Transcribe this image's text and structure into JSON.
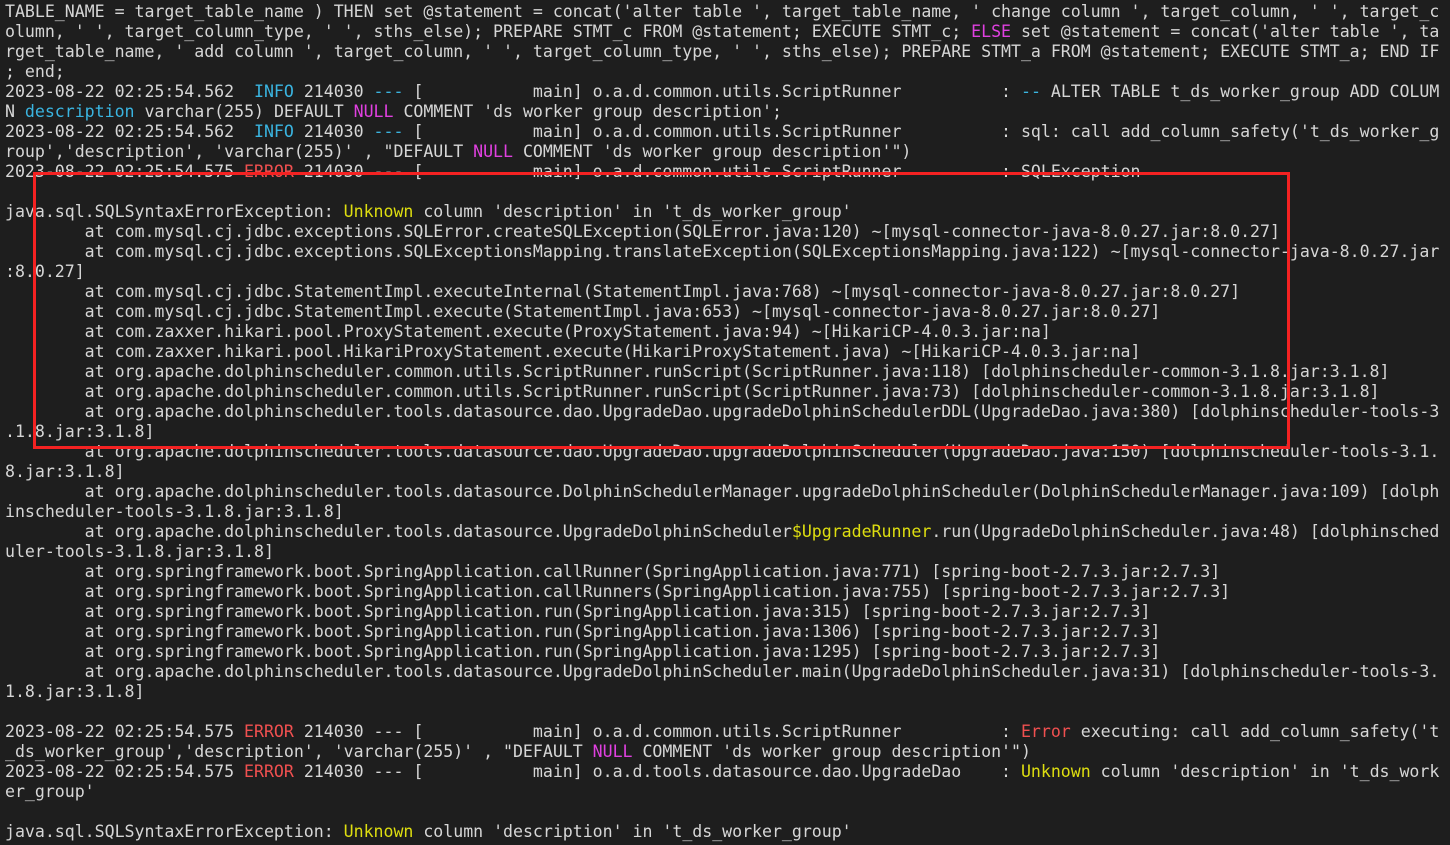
{
  "colors": {
    "background": "#1e1e1e",
    "text": "#d6d6d6",
    "info": "#3ab4e0",
    "null_keyword": "#e040e0",
    "error": "#f05050",
    "highlight": "#dede10",
    "annotation_box": "#f42222"
  },
  "lines": [
    [
      {
        "t": "TABLE_NAME = target_table_name ) THEN set @statement = concat('alter table ', target_table_name, ' change column ', target_column, ' ', target_c"
      }
    ],
    [
      {
        "t": "olumn, ' ', target_column_type, ' ', sths_else); PREPARE STMT_c FROM @statement; EXECUTE STMT_c; "
      },
      {
        "t": "ELSE",
        "c": "m"
      },
      {
        "t": " set @statement = concat('alter table ', ta"
      }
    ],
    [
      {
        "t": "rget_table_name, ' add column ', target_column, ' ', target_column_type, ' ', sths_else); PREPARE STMT_a FROM @statement; EXECUTE STMT_a; END IF"
      }
    ],
    [
      {
        "t": "; end;"
      }
    ],
    [
      {
        "t": "2023-08-22 02:25:54.562  "
      },
      {
        "t": "INFO",
        "c": "c"
      },
      {
        "t": " 214030 "
      },
      {
        "t": "---",
        "c": "c"
      },
      {
        "t": " [           main] o.a.d.common.utils.ScriptRunner          : "
      },
      {
        "t": "--",
        "c": "c"
      },
      {
        "t": " ALTER TABLE t_ds_worker_group ADD COLUM"
      }
    ],
    [
      {
        "t": "N "
      },
      {
        "t": "description",
        "c": "c"
      },
      {
        "t": " varchar(255) DEFAULT "
      },
      {
        "t": "NULL",
        "c": "m"
      },
      {
        "t": " COMMENT 'ds worker group description';"
      }
    ],
    [
      {
        "t": "2023-08-22 02:25:54.562  "
      },
      {
        "t": "INFO",
        "c": "c"
      },
      {
        "t": " 214030 "
      },
      {
        "t": "---",
        "c": "c"
      },
      {
        "t": " [           main] o.a.d.common.utils.ScriptRunner          : sql: call add_column_safety('t_ds_worker_g"
      }
    ],
    [
      {
        "t": "roup','description', 'varchar(255)' , \"DEFAULT "
      },
      {
        "t": "NULL",
        "c": "m"
      },
      {
        "t": " COMMENT 'ds worker group description'\")"
      }
    ],
    [
      {
        "t": "2023-08-22 02:25:54.575 "
      },
      {
        "t": "ERROR",
        "c": "r"
      },
      {
        "t": " 214030 --- [           main] o.a.d.common.utils.ScriptRunner          : SQLException"
      }
    ],
    [
      {
        "t": ""
      }
    ],
    [
      {
        "t": "java.sql.SQLSyntaxErrorException: "
      },
      {
        "t": "Unknown",
        "c": "y"
      },
      {
        "t": " column 'description' in 't_ds_worker_group'"
      }
    ],
    [
      {
        "t": "        at com.mysql.cj.jdbc.exceptions.SQLError.createSQLException(SQLError.java:120) ~[mysql-connector-java-8.0.27.jar:8.0.27]"
      }
    ],
    [
      {
        "t": "        at com.mysql.cj.jdbc.exceptions.SQLExceptionsMapping.translateException(SQLExceptionsMapping.java:122) ~[mysql-connector-java-8.0.27.jar"
      }
    ],
    [
      {
        "t": ":8.0.27]"
      }
    ],
    [
      {
        "t": "        at com.mysql.cj.jdbc.StatementImpl.executeInternal(StatementImpl.java:768) ~[mysql-connector-java-8.0.27.jar:8.0.27]"
      }
    ],
    [
      {
        "t": "        at com.mysql.cj.jdbc.StatementImpl.execute(StatementImpl.java:653) ~[mysql-connector-java-8.0.27.jar:8.0.27]"
      }
    ],
    [
      {
        "t": "        at com.zaxxer.hikari.pool.ProxyStatement.execute(ProxyStatement.java:94) ~[HikariCP-4.0.3.jar:na]"
      }
    ],
    [
      {
        "t": "        at com.zaxxer.hikari.pool.HikariProxyStatement.execute(HikariProxyStatement.java) ~[HikariCP-4.0.3.jar:na]"
      }
    ],
    [
      {
        "t": "        at org.apache.dolphinscheduler.common.utils.ScriptRunner.runScript(ScriptRunner.java:118) [dolphinscheduler-common-3.1.8.jar:3.1.8]"
      }
    ],
    [
      {
        "t": "        at org.apache.dolphinscheduler.common.utils.ScriptRunner.runScript(ScriptRunner.java:73) [dolphinscheduler-common-3.1.8.jar:3.1.8]"
      }
    ],
    [
      {
        "t": "        at org.apache.dolphinscheduler.tools.datasource.dao.UpgradeDao.upgradeDolphinSchedulerDDL(UpgradeDao.java:380) [dolphinscheduler-tools-3"
      }
    ],
    [
      {
        "t": ".1.8.jar:3.1.8]"
      }
    ],
    [
      {
        "t": "        at org.apache.dolphinscheduler.tools.datasource.dao.UpgradeDao.upgradeDolphinScheduler(UpgradeDao.java:150) [dolphinscheduler-tools-3.1."
      }
    ],
    [
      {
        "t": "8.jar:3.1.8]"
      }
    ],
    [
      {
        "t": "        at org.apache.dolphinscheduler.tools.datasource.DolphinSchedulerManager.upgradeDolphinScheduler(DolphinSchedulerManager.java:109) [dolph"
      }
    ],
    [
      {
        "t": "inscheduler-tools-3.1.8.jar:3.1.8]"
      }
    ],
    [
      {
        "t": "        at org.apache.dolphinscheduler.tools.datasource.UpgradeDolphinScheduler"
      },
      {
        "t": "$UpgradeRunner",
        "c": "y"
      },
      {
        "t": ".run(UpgradeDolphinScheduler.java:48) [dolphinsched"
      }
    ],
    [
      {
        "t": "uler-tools-3.1.8.jar:3.1.8]"
      }
    ],
    [
      {
        "t": "        at org.springframework.boot.SpringApplication.callRunner(SpringApplication.java:771) [spring-boot-2.7.3.jar:2.7.3]"
      }
    ],
    [
      {
        "t": "        at org.springframework.boot.SpringApplication.callRunners(SpringApplication.java:755) [spring-boot-2.7.3.jar:2.7.3]"
      }
    ],
    [
      {
        "t": "        at org.springframework.boot.SpringApplication.run(SpringApplication.java:315) [spring-boot-2.7.3.jar:2.7.3]"
      }
    ],
    [
      {
        "t": "        at org.springframework.boot.SpringApplication.run(SpringApplication.java:1306) [spring-boot-2.7.3.jar:2.7.3]"
      }
    ],
    [
      {
        "t": "        at org.springframework.boot.SpringApplication.run(SpringApplication.java:1295) [spring-boot-2.7.3.jar:2.7.3]"
      }
    ],
    [
      {
        "t": "        at org.apache.dolphinscheduler.tools.datasource.UpgradeDolphinScheduler.main(UpgradeDolphinScheduler.java:31) [dolphinscheduler-tools-3."
      }
    ],
    [
      {
        "t": "1.8.jar:3.1.8]"
      }
    ],
    [
      {
        "t": ""
      }
    ],
    [
      {
        "t": "2023-08-22 02:25:54.575 "
      },
      {
        "t": "ERROR",
        "c": "r"
      },
      {
        "t": " 214030 --- [           main] o.a.d.common.utils.ScriptRunner          : "
      },
      {
        "t": "Error",
        "c": "r"
      },
      {
        "t": " executing: call add_column_safety('t"
      }
    ],
    [
      {
        "t": "_ds_worker_group','description', 'varchar(255)' , \"DEFAULT "
      },
      {
        "t": "NULL",
        "c": "m"
      },
      {
        "t": " COMMENT 'ds worker group description'\")"
      }
    ],
    [
      {
        "t": "2023-08-22 02:25:54.575 "
      },
      {
        "t": "ERROR",
        "c": "r"
      },
      {
        "t": " 214030 --- [           main] o.a.d.tools.datasource.dao.UpgradeDao    : "
      },
      {
        "t": "Unknown",
        "c": "y"
      },
      {
        "t": " column 'description' in 't_ds_work"
      }
    ],
    [
      {
        "t": "er_group'"
      }
    ],
    [
      {
        "t": ""
      }
    ],
    [
      {
        "t": "java.sql.SQLSyntaxErrorException: "
      },
      {
        "t": "Unknown",
        "c": "y"
      },
      {
        "t": " column 'description' in 't_ds_worker_group'"
      }
    ]
  ]
}
